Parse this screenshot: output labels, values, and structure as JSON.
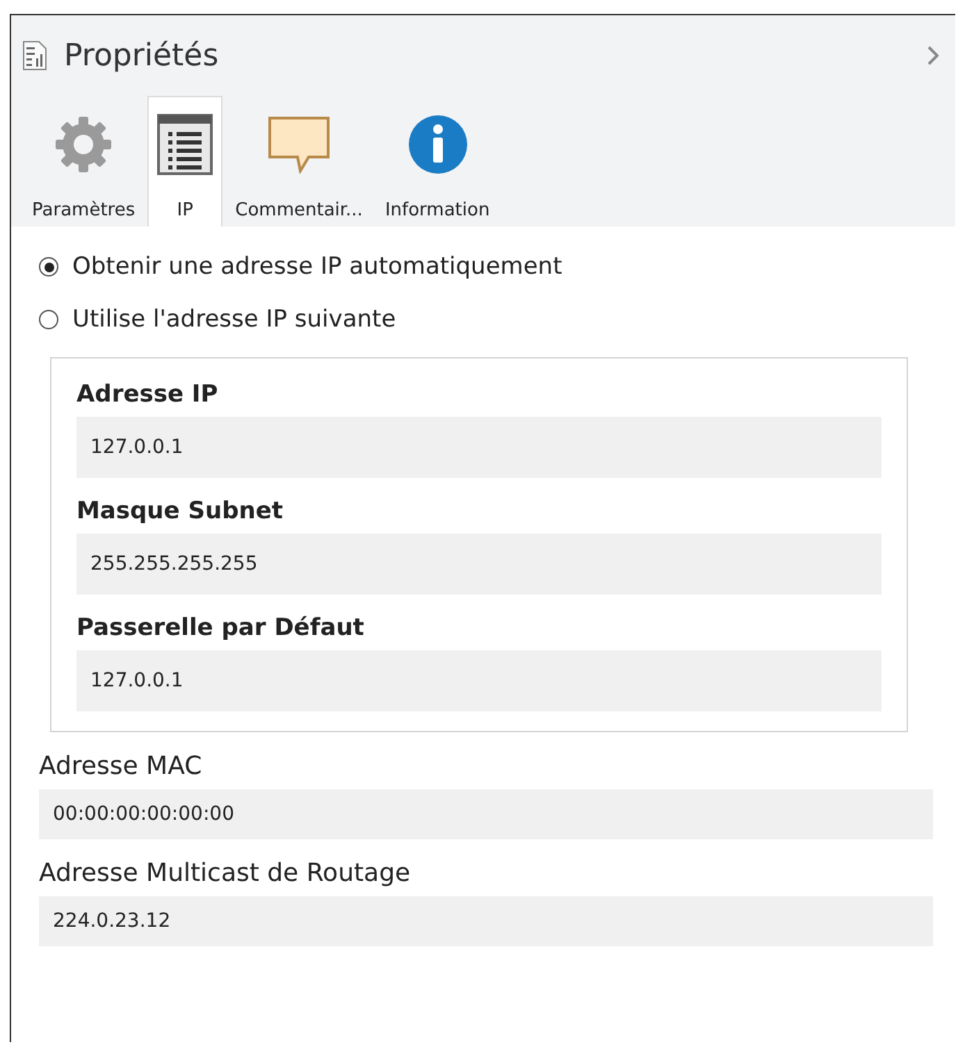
{
  "panel": {
    "title": "Propriétés"
  },
  "tabs": [
    {
      "label": "Paramètres",
      "kind": "gear",
      "selected": false
    },
    {
      "label": "IP",
      "kind": "list",
      "selected": true
    },
    {
      "label": "Commentair...",
      "kind": "comment",
      "selected": false
    },
    {
      "label": "Information",
      "kind": "info",
      "selected": false
    }
  ],
  "radios": [
    {
      "label": "Obtenir une adresse IP automatiquement",
      "selected": true
    },
    {
      "label": "Utilise l'adresse IP suivante",
      "selected": false
    }
  ],
  "group_fields": [
    {
      "label": "Adresse IP",
      "value": "127.0.0.1"
    },
    {
      "label": "Masque Subnet",
      "value": "255.255.255.255"
    },
    {
      "label": "Passerelle par Défaut",
      "value": "127.0.0.1"
    }
  ],
  "fields": [
    {
      "label": "Adresse MAC",
      "value": "00:00:00:00:00:00"
    },
    {
      "label": "Adresse Multicast de Routage",
      "value": "224.0.23.12"
    }
  ]
}
